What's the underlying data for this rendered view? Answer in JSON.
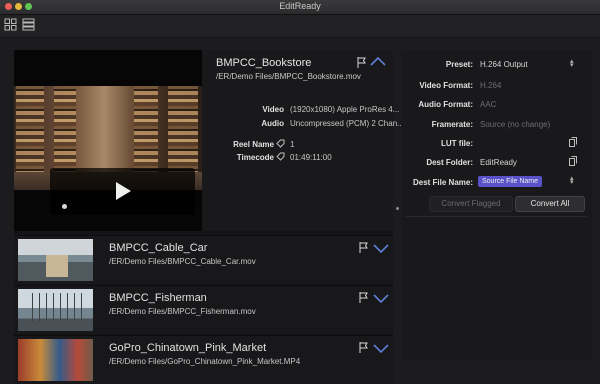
{
  "window": {
    "title": "EditReady"
  },
  "toolbar": {
    "grid_view_icon": "grid-icon",
    "list_view_icon": "list-icon"
  },
  "hero": {
    "title": "BMPCC_Bookstore",
    "path": "/ER/Demo Files/BMPCC_Bookstore.mov",
    "video_label": "Video",
    "video_value": "(1920x1080) Apple ProRes 4...",
    "audio_label": "Audio",
    "audio_value": "Uncompressed (PCM) 2 Chan...",
    "reel_label": "Reel Name",
    "reel_value": "1",
    "timecode_label": "Timecode",
    "timecode_value": "01:49:11:00"
  },
  "clips": [
    {
      "title": "BMPCC_Cable_Car",
      "path": "/ER/Demo Files/BMPCC_Cable_Car.mov"
    },
    {
      "title": "BMPCC_Fisherman",
      "path": "/ER/Demo Files/BMPCC_Fisherman.mov"
    },
    {
      "title": "GoPro_Chinatown_Pink_Market",
      "path": "/ER/Demo Files/GoPro_Chinatown_Pink_Market.MP4"
    }
  ],
  "settings": {
    "preset_label": "Preset:",
    "preset_value": "H.264 Output",
    "video_format_label": "Video Format:",
    "video_format_value": "H.264",
    "audio_format_label": "Audio Format:",
    "audio_format_value": "AAC",
    "framerate_label": "Framerate:",
    "framerate_value": "Source (no change)",
    "lut_label": "LUT file:",
    "dest_folder_label": "Dest Folder:",
    "dest_folder_value": "EditReady",
    "dest_name_label": "Dest File Name:",
    "dest_name_token": "Source File Name",
    "convert_flagged": "Convert Flagged",
    "convert_all": "Convert All"
  },
  "colors": {
    "accent": "#5a52c8",
    "background": "#1c1c1e"
  }
}
